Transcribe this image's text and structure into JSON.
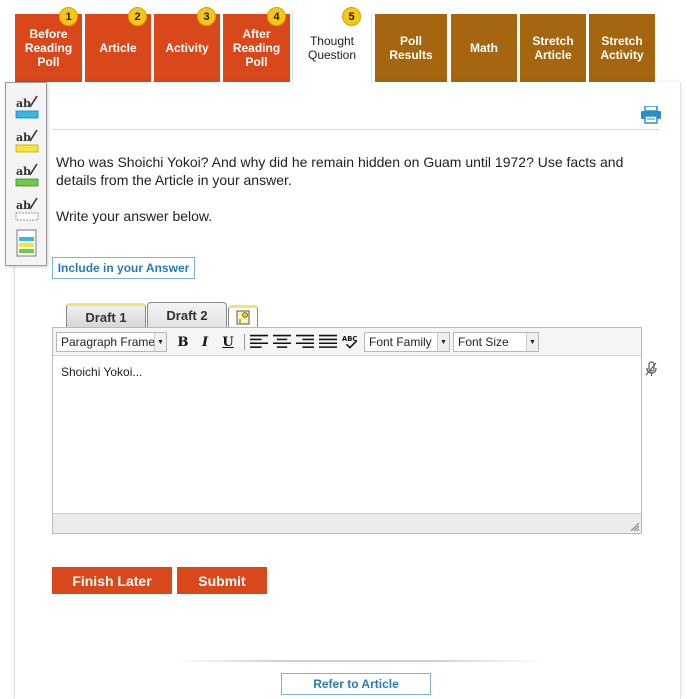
{
  "colors": {
    "tab_red": "#d9481a",
    "tab_brown": "#a5660f",
    "badge_yellow": "#f5c518",
    "link_blue": "#2a7ab8",
    "button_red": "#d9481a"
  },
  "tabs": [
    {
      "label": "Before\nReading\nPoll",
      "number": "1"
    },
    {
      "label": "Article",
      "number": "2"
    },
    {
      "label": "Activity",
      "number": "3"
    },
    {
      "label": "After\nReading\nPoll",
      "number": "4"
    },
    {
      "label": "Thought\nQuestion",
      "number": "5"
    },
    {
      "label": "Poll\nResults"
    },
    {
      "label": "Math"
    },
    {
      "label": "Stretch\nArticle"
    },
    {
      "label": "Stretch\nActivity"
    }
  ],
  "highlighter": {
    "tools": [
      {
        "icon": "highlighter-blue-icon"
      },
      {
        "icon": "highlighter-yellow-icon"
      },
      {
        "icon": "highlighter-green-icon"
      },
      {
        "icon": "eraser-highlight-icon"
      },
      {
        "icon": "notes-icon"
      }
    ]
  },
  "question": {
    "text": "Who was Shoichi Yokoi? And why did he remain hidden on Guam until 1972? Use facts and details from the Article in your answer.",
    "instruction": "Write your answer below."
  },
  "include_button": "Include in your Answer",
  "drafts": [
    "Draft 1",
    "Draft 2"
  ],
  "editor": {
    "paragraph_format": "Paragraph Frames",
    "font_family": "Font Family",
    "font_size": "Font Size",
    "bold": "B",
    "italic": "I",
    "underline": "U",
    "content": "Shoichi Yokoi..."
  },
  "buttons": {
    "finish_later": "Finish Later",
    "submit": "Submit",
    "refer_to_article": "Refer to Article"
  }
}
